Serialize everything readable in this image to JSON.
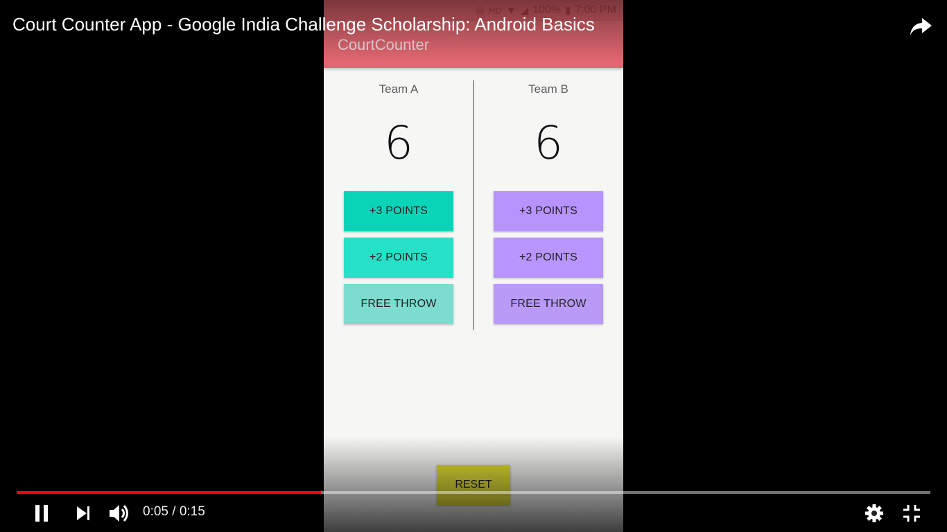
{
  "video": {
    "title": "Court Counter App - Google India Challenge Scholarship: Android Basics",
    "current_time": "0:05",
    "separator": "/",
    "duration": "0:15",
    "progress_fraction": 0.3333
  },
  "status_bar": {
    "network": "HD",
    "battery": "100%",
    "time": "7:00 PM"
  },
  "app": {
    "title": "CourtCounter",
    "team_a": {
      "name": "Team A",
      "score": "6",
      "color_3": "#0ad4b8",
      "color_2": "#24e1c7",
      "color_ft": "#7cdccf"
    },
    "team_b": {
      "name": "Team B",
      "score": "6",
      "color_3": "#b793ff",
      "color_2": "#b895ff",
      "color_ft": "#b99af7"
    },
    "buttons": {
      "three": "+3 POINTS",
      "two": "+2 POINTS",
      "free": "FREE THROW"
    },
    "reset": "RESET"
  },
  "colors": {
    "progress": "#ff0000",
    "app_bar": "#e36772",
    "reset": "#e5e23a"
  },
  "icons": [
    "pause-icon",
    "next-icon",
    "volume-icon",
    "settings-icon",
    "exit-fullscreen-icon",
    "share-icon"
  ]
}
